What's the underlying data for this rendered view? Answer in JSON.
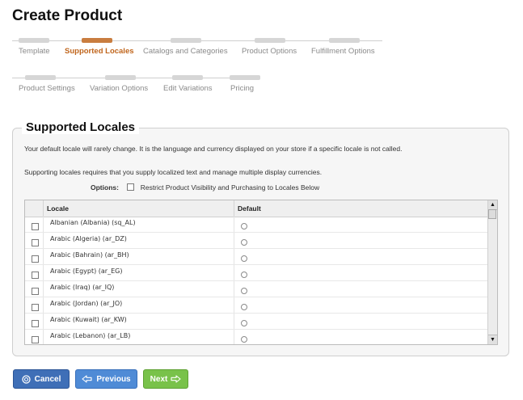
{
  "page": {
    "title": "Create Product"
  },
  "wizard": {
    "rows": [
      [
        {
          "label": "Template",
          "active": false
        },
        {
          "label": "Supported Locales",
          "active": true
        },
        {
          "label": "Catalogs and Categories",
          "active": false
        },
        {
          "label": "Product Options",
          "active": false
        },
        {
          "label": "Fulfillment Options",
          "active": false
        }
      ],
      [
        {
          "label": "Product Settings",
          "active": false
        },
        {
          "label": "Variation Options",
          "active": false
        },
        {
          "label": "Edit Variations",
          "active": false
        },
        {
          "label": "Pricing",
          "active": false
        }
      ]
    ]
  },
  "panel": {
    "title": "Supported Locales",
    "intro1": "Your default locale will rarely change. It is the language and currency displayed on your store if a specific locale is not called.",
    "intro2": "Supporting locales requires that you supply localized text and manage multiple display currencies.",
    "options_label": "Options:",
    "restrict_label": "Restrict Product Visibility and Purchasing to Locales Below",
    "restrict_checked": false
  },
  "table": {
    "col_locale": "Locale",
    "col_default": "Default",
    "rows": [
      {
        "name": "Albanian (Albania) (sq_AL)",
        "checked": false,
        "default": false
      },
      {
        "name": "Arabic (Algeria) (ar_DZ)",
        "checked": false,
        "default": false
      },
      {
        "name": "Arabic (Bahrain) (ar_BH)",
        "checked": false,
        "default": false
      },
      {
        "name": "Arabic (Egypt) (ar_EG)",
        "checked": false,
        "default": false
      },
      {
        "name": "Arabic (Iraq) (ar_IQ)",
        "checked": false,
        "default": false
      },
      {
        "name": "Arabic (Jordan) (ar_JO)",
        "checked": false,
        "default": false
      },
      {
        "name": "Arabic (Kuwait) (ar_KW)",
        "checked": false,
        "default": false
      },
      {
        "name": "Arabic (Lebanon) (ar_LB)",
        "checked": false,
        "default": false
      }
    ]
  },
  "buttons": {
    "cancel": "Cancel",
    "previous": "Previous",
    "next": "Next"
  },
  "icons": {
    "cancel": "cancel-icon",
    "previous": "arrow-left-icon",
    "next": "arrow-right-icon"
  },
  "colors": {
    "active_step": "#c0651c",
    "cancel": "#3f6fb7",
    "previous": "#4f8bd6",
    "next": "#79c24a"
  }
}
